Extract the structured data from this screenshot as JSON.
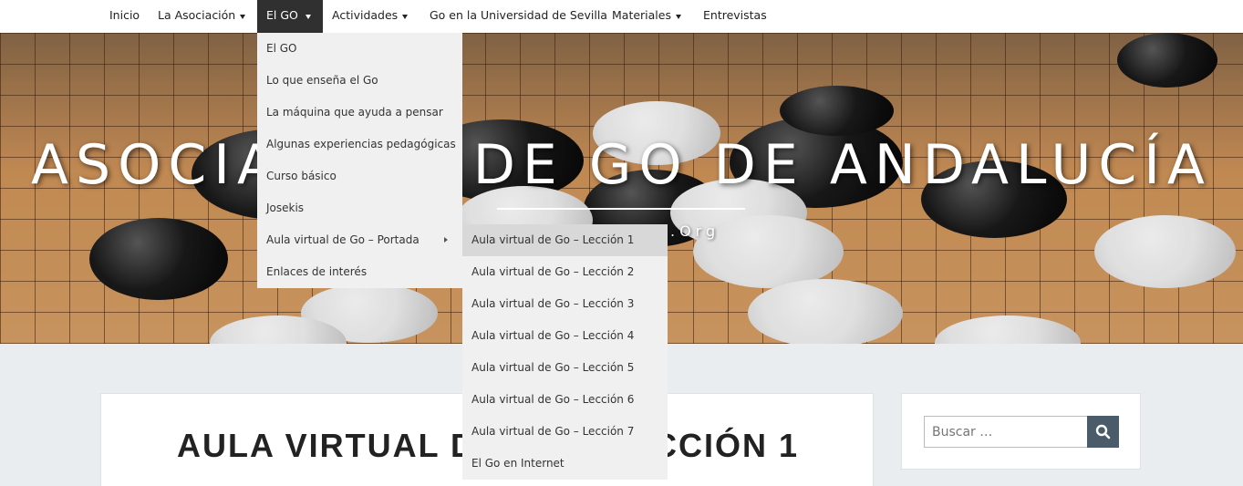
{
  "nav": {
    "items": [
      {
        "label": "Inicio"
      },
      {
        "label": "La Asociación"
      },
      {
        "label": "El GO"
      },
      {
        "label": "Actividades"
      },
      {
        "label": "Go en la Universidad de Sevilla"
      },
      {
        "label": "Materiales"
      },
      {
        "label": "Entrevistas"
      }
    ],
    "active_index": 2
  },
  "hero": {
    "title": "ASOCIACIÓN DE GO DE ANDALUCÍA",
    "tagline": ".Org"
  },
  "dropdown": {
    "items": [
      {
        "label": "El GO"
      },
      {
        "label": "Lo que enseña el Go"
      },
      {
        "label": "La máquina que ayuda a pensar"
      },
      {
        "label": "Algunas experiencias pedagógicas"
      },
      {
        "label": "Curso básico"
      },
      {
        "label": "Josekis"
      },
      {
        "label": "Aula virtual de Go – Portada"
      },
      {
        "label": "Enlaces de interés"
      }
    ]
  },
  "submenu": {
    "items": [
      {
        "label": "Aula virtual de Go – Lección 1"
      },
      {
        "label": "Aula virtual de Go – Lección 2"
      },
      {
        "label": "Aula virtual de Go – Lección 3"
      },
      {
        "label": "Aula virtual de Go – Lección 4"
      },
      {
        "label": "Aula virtual de Go – Lección 5"
      },
      {
        "label": "Aula virtual de Go – Lección 6"
      },
      {
        "label": "Aula virtual de Go – Lección 7"
      },
      {
        "label": "El Go en Internet"
      }
    ]
  },
  "main": {
    "post_title": "AULA VIRTUAL DE GO – LECCIÓN 1"
  },
  "sidebar": {
    "search_placeholder": "Buscar …",
    "search_icon": "search-icon"
  },
  "colors": {
    "nav_active_bg": "#303030",
    "dropdown_bg": "#f0f0f0",
    "dropdown_hover_bg": "#d8d8d8",
    "search_button_bg": "#4a5c6a",
    "page_bg": "#e9edf0"
  }
}
